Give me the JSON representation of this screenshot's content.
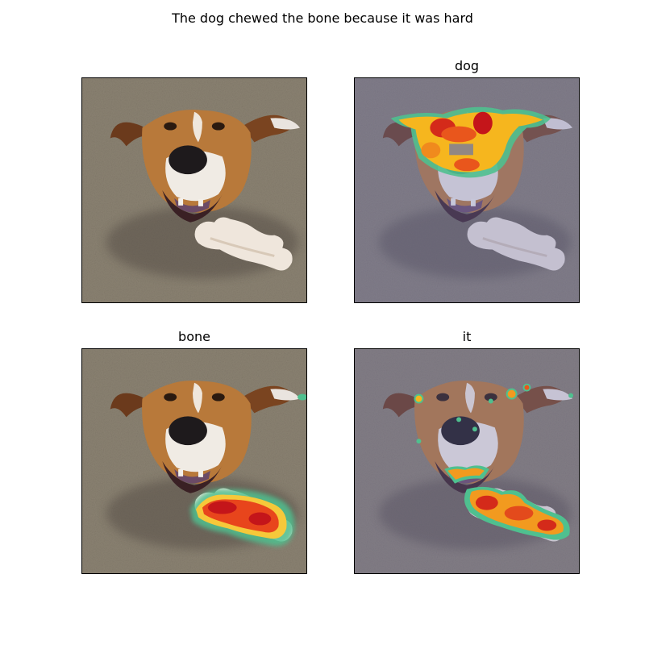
{
  "suptitle": "The dog chewed the bone because it was hard",
  "panels": [
    {
      "title": "",
      "overlay": "none"
    },
    {
      "title": "dog",
      "overlay": "attention-heatmap"
    },
    {
      "title": "bone",
      "overlay": "attention-heatmap"
    },
    {
      "title": "it",
      "overlay": "attention-heatmap"
    }
  ],
  "colors": {
    "pavement": "#8b8272",
    "pavement_tint": "#7f7f95",
    "fur": "#b8793a",
    "heat_hot": "#d42a1a",
    "heat_warm": "#f6a21d",
    "heat_edge": "#5fc18a"
  }
}
